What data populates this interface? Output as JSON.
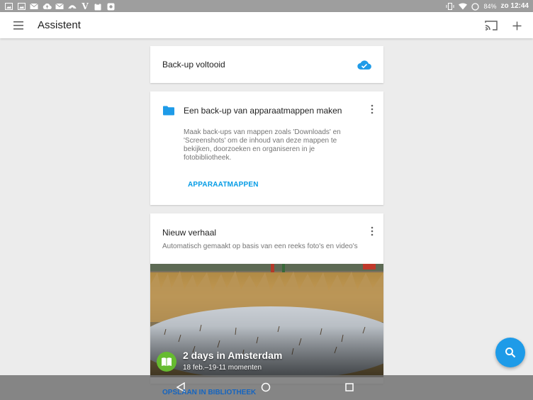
{
  "status_bar": {
    "icons_left": [
      "image-icon",
      "image-icon",
      "mail-icon",
      "cloud-upload-icon",
      "mail-icon",
      "signal-icon",
      "v-icon",
      "clipboard-icon",
      "photos-icon"
    ],
    "battery": "84%",
    "time": "zo 12:44"
  },
  "app_bar": {
    "title": "Assistent"
  },
  "card_backup": {
    "label": "Back-up voltooid"
  },
  "card_folders": {
    "title": "Een back-up van apparaatmappen maken",
    "description": "Maak back-ups van mappen zoals 'Downloads' en 'Screenshots' om de inhoud van deze mappen te bekijken, doorzoeken en organiseren in je fotobibliotheek.",
    "action": "APPARAATMAPPEN"
  },
  "card_story": {
    "title": "Nieuw verhaal",
    "description": "Automatisch gemaakt op basis van een reeks foto's en video's",
    "story_title": "2 days in Amsterdam",
    "story_sub": "18 feb.–19-11 momenten",
    "action": "OPSLAAN IN BIBLIOTHEEK"
  },
  "colors": {
    "accent": "#039be5",
    "fab": "#1e9be8",
    "story_badge": "#66bb30"
  }
}
